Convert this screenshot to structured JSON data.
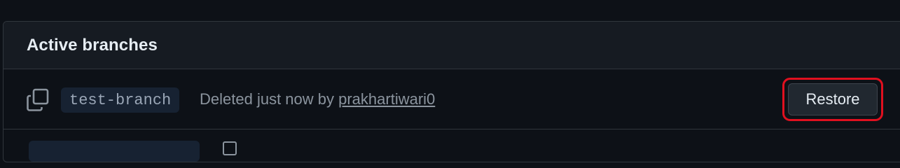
{
  "panel": {
    "title": "Active branches"
  },
  "branches": [
    {
      "name": "test-branch",
      "status_prefix": "Deleted just now by ",
      "user": "prakhartiwari0",
      "action_label": "Restore",
      "copy_icon": "copy-icon"
    }
  ],
  "colors": {
    "background": "#0d1117",
    "header_bg": "#161b22",
    "border": "#30363d",
    "branch_pill_bg": "#172232",
    "muted_text": "#8b949e",
    "highlight_outline": "#e0101f"
  }
}
